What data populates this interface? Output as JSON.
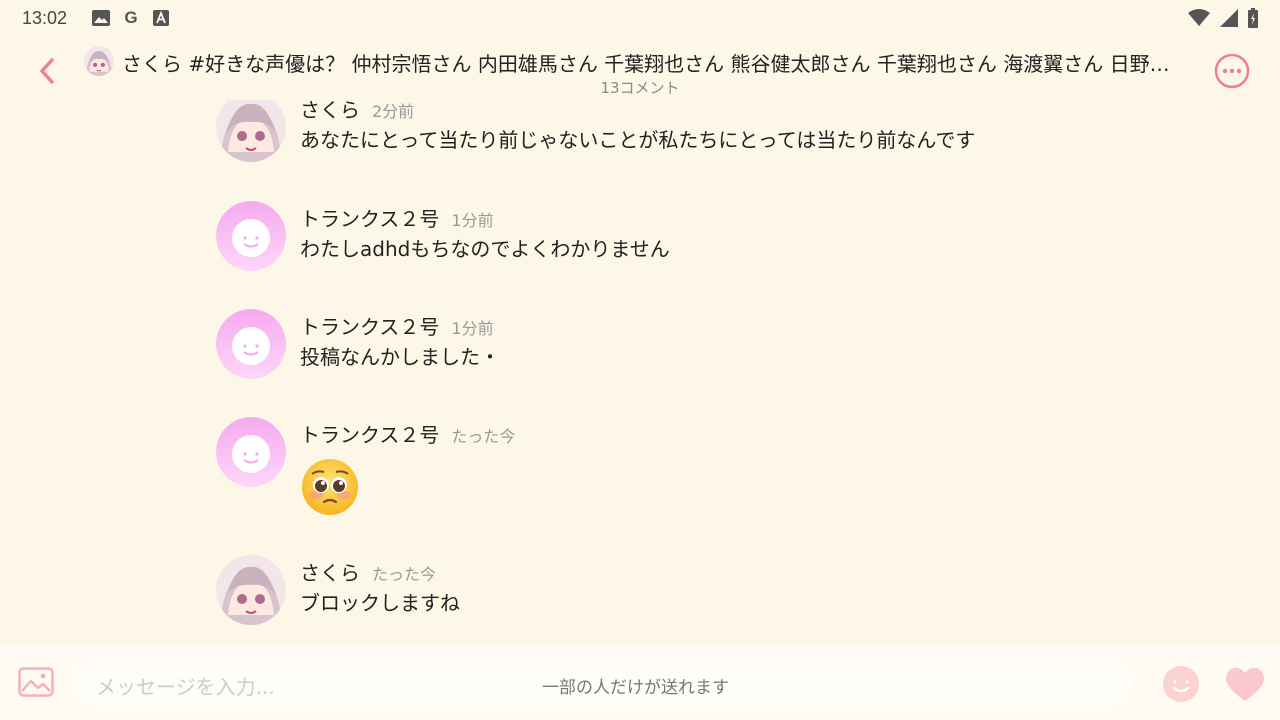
{
  "status_bar": {
    "time": "13:02",
    "left_icons": [
      "image-icon",
      "google-icon",
      "font-icon"
    ],
    "right_icons": [
      "wifi-icon",
      "signal-icon",
      "battery-icon"
    ],
    "google_glyph": "G",
    "font_glyph": "A"
  },
  "header": {
    "title": "さくら #好きな声優は？ 仲村宗悟さん 内田雄馬さん 千葉翔也さん 熊谷健太郎さん 千葉翔也さん 海渡翼さん 日野…",
    "comment_count": "13コメント"
  },
  "messages": [
    {
      "name": "さくら",
      "time": "2分前",
      "text": "あなたにとって当たり前じゃないことが私たちにとっては当たり前なんです",
      "avatar": "anime-avatar"
    },
    {
      "name": "トランクス２号",
      "time": "1分前",
      "text": "わたしadhdもちなのでよくわかりません",
      "avatar": "default-avatar"
    },
    {
      "name": "トランクス２号",
      "time": "1分前",
      "text": "投稿なんかしました・",
      "avatar": "default-avatar"
    },
    {
      "name": "トランクス２号",
      "time": "たった今",
      "text": "",
      "emoji": "pleading-face-emoji",
      "avatar": "default-avatar"
    },
    {
      "name": "さくら",
      "time": "たった今",
      "text": "ブロックしますね",
      "avatar": "anime-avatar"
    }
  ],
  "input": {
    "placeholder": "メッセージを入力...",
    "hint": "一部の人だけが送れます"
  },
  "colors": {
    "background": "#fdf7e8",
    "accent_pink": "#ef7f95",
    "avatar_pink": "#f6a9f0"
  }
}
